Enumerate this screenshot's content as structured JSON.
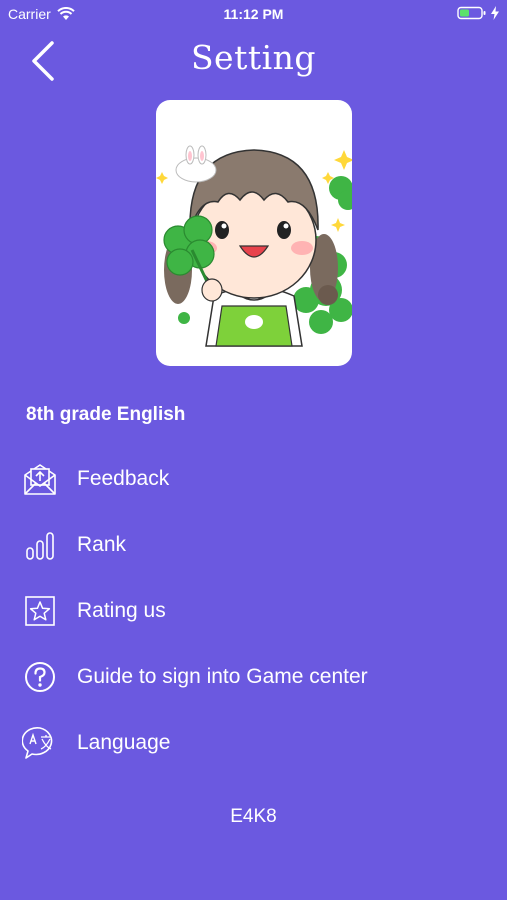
{
  "status_bar": {
    "carrier": "Carrier",
    "time": "11:12 PM"
  },
  "header": {
    "title": "Setting",
    "back_icon": "chevron-left-icon"
  },
  "profile": {
    "avatar": "cartoon-girl-with-clover-illustration",
    "grade": "8th grade English"
  },
  "menu": [
    {
      "label": "Feedback",
      "icon": "mail-feedback-icon"
    },
    {
      "label": "Rank",
      "icon": "bar-chart-icon"
    },
    {
      "label": "Rating us",
      "icon": "star-box-icon"
    },
    {
      "label": "Guide to sign into Game center",
      "icon": "question-circle-icon"
    },
    {
      "label": "Language",
      "icon": "translate-bubble-icon"
    }
  ],
  "footer": {
    "code": "E4K8"
  },
  "colors": {
    "background": "#6b59e0",
    "text": "#ffffff",
    "card": "#ffffff"
  }
}
